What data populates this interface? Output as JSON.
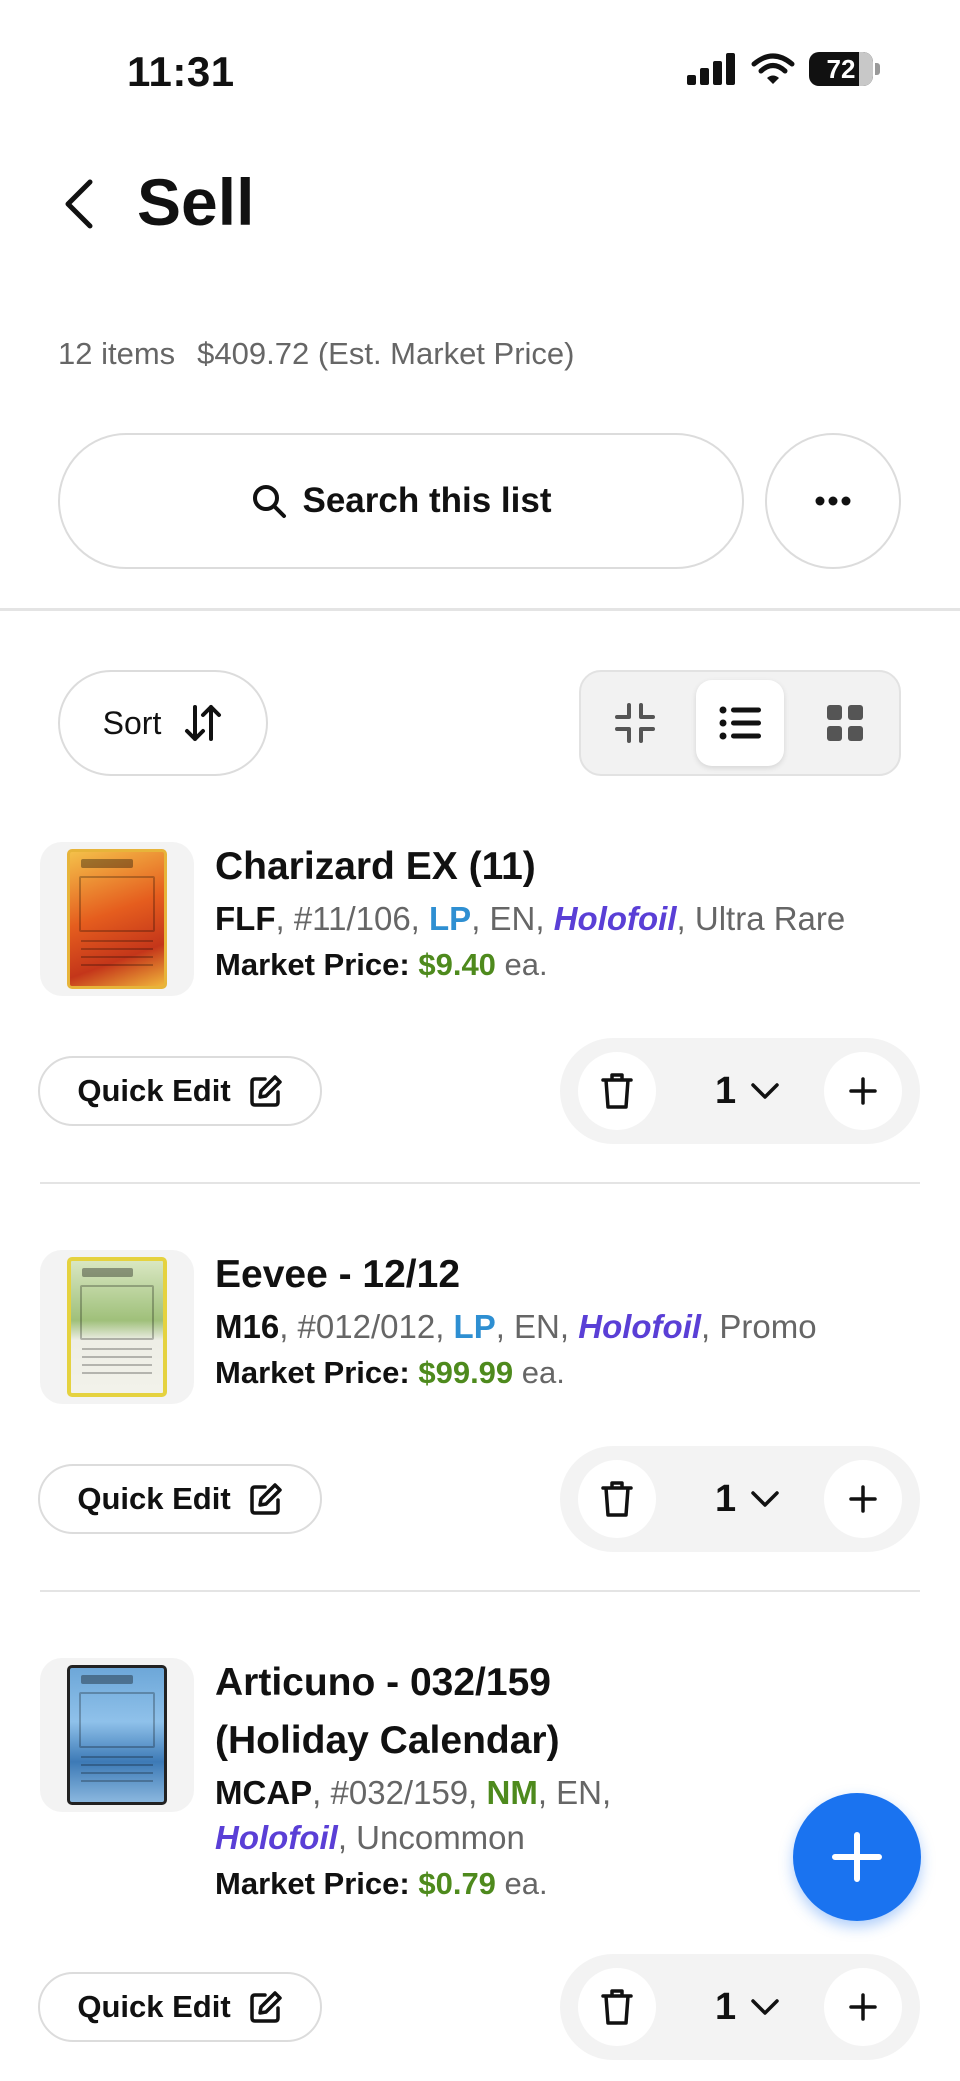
{
  "status_bar": {
    "time": "11:31",
    "battery": "72"
  },
  "header": {
    "title": "Sell"
  },
  "summary": {
    "items": "12 items",
    "price": "$409.72 (Est. Market Price)"
  },
  "search": {
    "label": "Search this list"
  },
  "sort": {
    "label": "Sort"
  },
  "view_modes": [
    "compact",
    "list",
    "grid"
  ],
  "view_mode_selected": "list",
  "items": [
    {
      "name": "Charizard EX (11)",
      "set": "FLF",
      "number": "#11/106",
      "condition": "LP",
      "language": "EN",
      "printing": "Holofoil",
      "rarity": "Ultra Rare",
      "price_label": "Market Price:",
      "price": "$9.40",
      "price_suffix": "ea.",
      "quick_edit": "Quick Edit",
      "quantity": "1"
    },
    {
      "name": "Eevee - 12/12",
      "set": "M16",
      "number": "#012/012",
      "condition": "LP",
      "language": "EN",
      "printing": "Holofoil",
      "rarity": "Promo",
      "price_label": "Market Price:",
      "price": "$99.99",
      "price_suffix": "ea.",
      "quick_edit": "Quick Edit",
      "quantity": "1"
    },
    {
      "name": "Articuno - 032/159",
      "name_line2": "(Holiday Calendar)",
      "set": "MCAP",
      "number": "#032/159",
      "condition": "NM",
      "language": "EN",
      "printing": "Holofoil",
      "rarity": "Uncommon",
      "price_label": "Market Price:",
      "price": "$0.79",
      "price_suffix": "ea.",
      "quick_edit": "Quick Edit",
      "quantity": "1"
    }
  ],
  "colors": {
    "accent_blue": "#1a73f0",
    "price_green": "#4e8a1d",
    "condition_lp": "#2e8fd2",
    "condition_nm": "#4e8a1d",
    "holofoil_purple": "#5a3fd6"
  }
}
